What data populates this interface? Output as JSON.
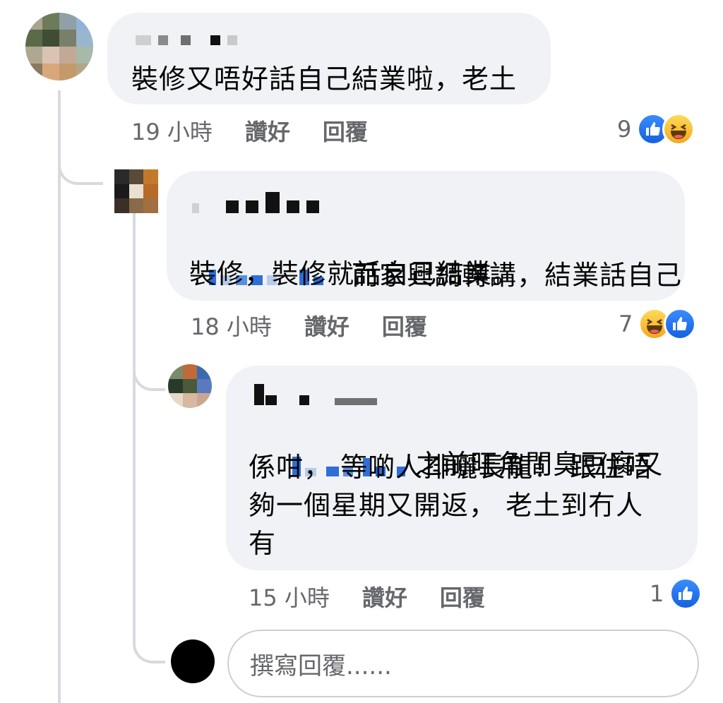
{
  "comments": [
    {
      "text": "裝修又唔好話自己結業啦，老土",
      "time": "19 小時",
      "like_label": "讚好",
      "reply_label": "回覆",
      "reaction_count": "9",
      "reactions": [
        "like-icon",
        "haha-icon"
      ]
    },
    {
      "text_line1": "而家興調轉講，結業話自己",
      "text_line2": "裝修，裝修就話自己結業。",
      "time": "18 小時",
      "like_label": "讚好",
      "reply_label": "回覆",
      "reaction_count": "7",
      "reactions": [
        "haha-icon",
        "like-icon"
      ]
    },
    {
      "text_line1": "之前旺角間臭豆腐又",
      "text_line2": "係咁， 等啲人排曬長龍！ 跟住唔",
      "text_line3": "夠一個星期又開返， 老土到冇人",
      "text_line4": "有",
      "time": "15 小時",
      "like_label": "讚好",
      "reply_label": "回覆",
      "reaction_count": "1",
      "reactions": [
        "like-icon"
      ]
    }
  ],
  "reply_box": {
    "placeholder": "撰寫回覆......"
  },
  "colors": {
    "bubble": "#f0f2f5",
    "meta_text": "#65676b",
    "like_blue": "#1877f2",
    "haha_yellow": "#f7b125",
    "thread_line": "#d8dadf"
  }
}
